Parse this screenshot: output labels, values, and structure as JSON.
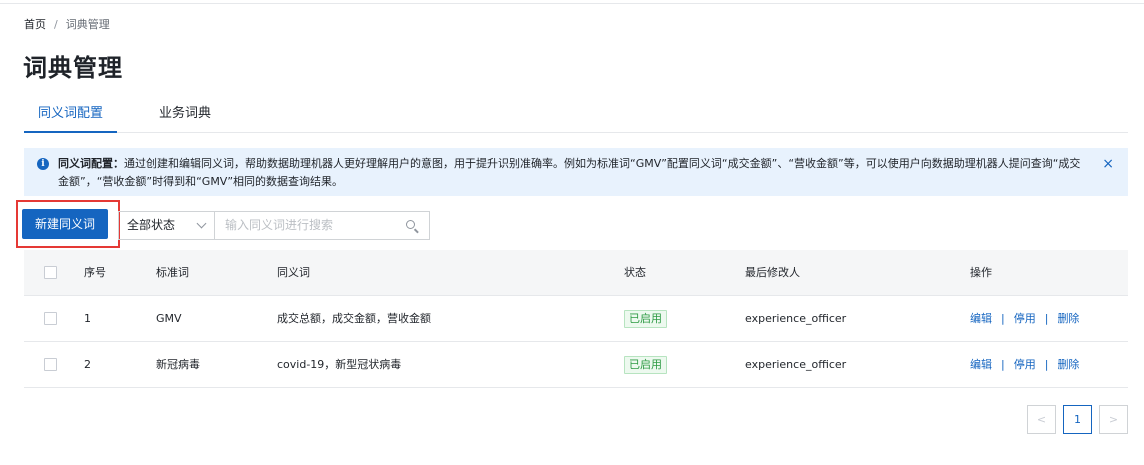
{
  "breadcrumb": {
    "home": "首页",
    "separator": "/",
    "current": "词典管理"
  },
  "page": {
    "title": "词典管理"
  },
  "tabs": [
    {
      "label": "同义词配置",
      "active": true
    },
    {
      "label": "业务词典",
      "active": false
    }
  ],
  "alert": {
    "title": "同义词配置：",
    "text": "通过创建和编辑同义词，帮助数据助理机器人更好理解用户的意图，用于提升识别准确率。例如为标准词“GMV”配置同义词“成交金额”、“营收金额”等，可以使用户向数据助理机器人提问查询“成交金额”，“营收金额”时得到和“GMV”相同的数据查询结果。",
    "close": "×"
  },
  "toolbar": {
    "new_label": "新建同义词",
    "status_value": "全部状态",
    "search_placeholder": "输入同义词进行搜索"
  },
  "table": {
    "headers": {
      "index": "序号",
      "standard": "标准词",
      "synonyms": "同义词",
      "status": "状态",
      "modifier": "最后修改人",
      "actions": "操作"
    },
    "rows": [
      {
        "index": "1",
        "standard": "GMV",
        "synonyms": "成交总额，成交金额，营收金额",
        "status": "已启用",
        "modifier": "experience_officer"
      },
      {
        "index": "2",
        "standard": "新冠病毒",
        "synonyms": "covid-19，新型冠状病毒",
        "status": "已启用",
        "modifier": "experience_officer"
      }
    ],
    "actions": {
      "edit": "编辑",
      "disable": "停用",
      "delete": "删除",
      "sep": "|"
    }
  },
  "pagination": {
    "prev": "<",
    "current": "1",
    "next": ">"
  },
  "colors": {
    "primary": "#1565c0",
    "highlight": "#e53935",
    "success": "#2e9b44",
    "alert_bg": "#e8f2fd"
  }
}
